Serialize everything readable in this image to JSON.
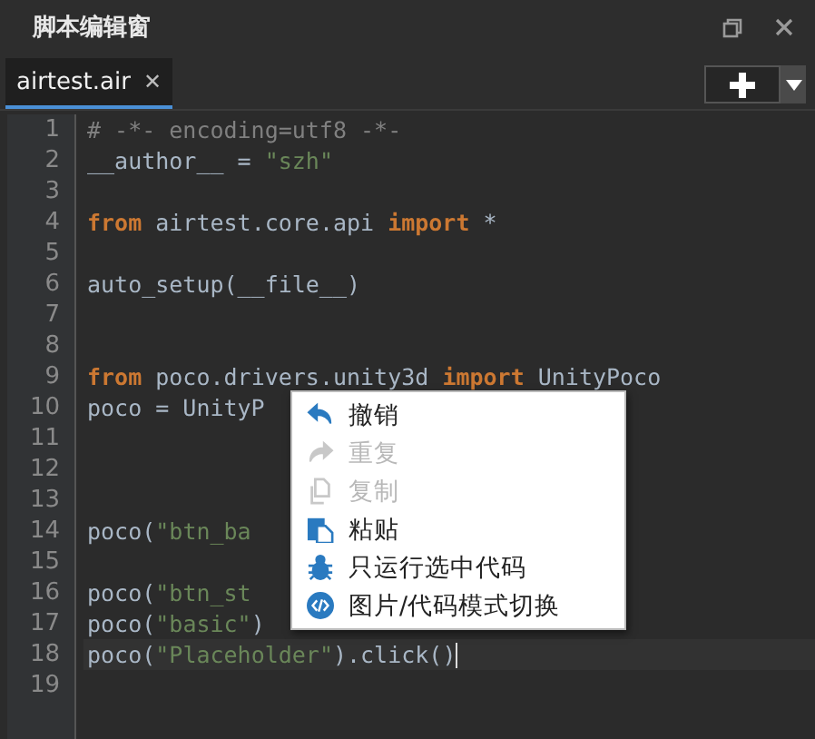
{
  "window": {
    "title": "脚本编辑窗"
  },
  "tabs": [
    {
      "label": "airtest.air",
      "selected": true,
      "close": "✕"
    }
  ],
  "editor": {
    "lines": [
      {
        "number": "1",
        "current": false,
        "tokens": [
          {
            "kind": "comment",
            "text": "# -*- encoding=utf8 -*-"
          }
        ]
      },
      {
        "number": "2",
        "current": false,
        "tokens": [
          {
            "kind": "plain",
            "text": "__author__ = "
          },
          {
            "kind": "string",
            "text": "\"szh\""
          }
        ]
      },
      {
        "number": "3",
        "current": false
      },
      {
        "number": "4",
        "current": false,
        "tokens": [
          {
            "kind": "keyword",
            "text": "from"
          },
          {
            "kind": "plain",
            "text": " airtest.core.api "
          },
          {
            "kind": "keyword",
            "text": "import"
          },
          {
            "kind": "plain",
            "text": " *"
          }
        ]
      },
      {
        "number": "5",
        "current": false
      },
      {
        "number": "6",
        "current": false,
        "tokens": [
          {
            "kind": "plain",
            "text": "auto_setup(__file__)"
          }
        ]
      },
      {
        "number": "7",
        "current": false
      },
      {
        "number": "8",
        "current": false
      },
      {
        "number": "9",
        "current": false,
        "tokens": [
          {
            "kind": "keyword",
            "text": "from"
          },
          {
            "kind": "plain",
            "text": " poco.drivers.unity3d "
          },
          {
            "kind": "keyword",
            "text": "import"
          },
          {
            "kind": "plain",
            "text": " UnityPoco"
          }
        ]
      },
      {
        "number": "10",
        "current": false,
        "tokens": [
          {
            "kind": "plain",
            "text": "poco = UnityP"
          }
        ]
      },
      {
        "number": "11",
        "current": false
      },
      {
        "number": "12",
        "current": false
      },
      {
        "number": "13",
        "current": false
      },
      {
        "number": "14",
        "current": false,
        "tokens": [
          {
            "kind": "plain",
            "text": "poco("
          },
          {
            "kind": "string",
            "text": "\"btn_ba"
          }
        ]
      },
      {
        "number": "15",
        "current": false
      },
      {
        "number": "16",
        "current": false,
        "tokens": [
          {
            "kind": "plain",
            "text": "poco("
          },
          {
            "kind": "string",
            "text": "\"btn_st"
          }
        ]
      },
      {
        "number": "17",
        "current": false,
        "tokens": [
          {
            "kind": "plain",
            "text": "poco("
          },
          {
            "kind": "string",
            "text": "\"basic\""
          },
          {
            "kind": "plain",
            "text": ")"
          }
        ]
      },
      {
        "number": "18",
        "current": true,
        "tokens": [
          {
            "kind": "plain",
            "text": "poco("
          },
          {
            "kind": "string",
            "text": "\"Placeholder\""
          },
          {
            "kind": "plain",
            "text": ").click()"
          }
        ]
      },
      {
        "number": "19",
        "current": false
      }
    ]
  },
  "context_menu": {
    "items": [
      {
        "kind": "undo",
        "label": "撤销",
        "disabled": false
      },
      {
        "kind": "redo",
        "label": "重复",
        "disabled": true
      },
      {
        "kind": "copy",
        "label": "复制",
        "disabled": true
      },
      {
        "kind": "paste",
        "label": "粘贴",
        "disabled": false
      },
      {
        "kind": "run",
        "label": "只运行选中代码",
        "disabled": false
      },
      {
        "kind": "toggle",
        "label": "图片/代码模式切换",
        "disabled": false
      }
    ]
  }
}
